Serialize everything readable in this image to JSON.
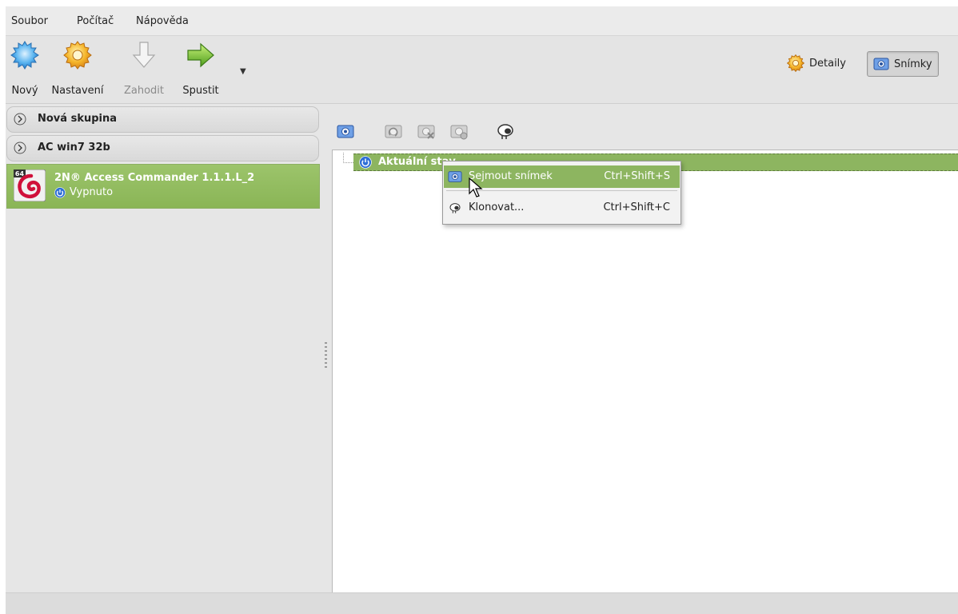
{
  "menubar": {
    "items": [
      {
        "label": "Soubor"
      },
      {
        "label": "Počítač"
      },
      {
        "label": "Nápověda"
      }
    ]
  },
  "toolbar": {
    "buttons": [
      {
        "label": "Nový",
        "icon": "new-vm-icon",
        "enabled": true
      },
      {
        "label": "Nastavení",
        "icon": "settings-gear-icon",
        "enabled": true
      },
      {
        "label": "Zahodit",
        "icon": "discard-arrow-icon",
        "enabled": false
      },
      {
        "label": "Spustit",
        "icon": "start-arrow-icon",
        "enabled": true
      }
    ],
    "details_label": "Detaily",
    "snapshots_label": "Snímky"
  },
  "vm_list": {
    "groups": [
      {
        "label": "Nová skupina"
      },
      {
        "label": "AC win7 32b"
      }
    ],
    "selected_vm": {
      "name": "2N® Access Commander 1.1.1.L_2",
      "state": "Vypnuto",
      "badge": "64"
    }
  },
  "snapshots": {
    "toolbar_icons": [
      "take-snapshot-icon",
      "restore-snapshot-icon",
      "delete-snapshot-icon",
      "snapshot-details-icon",
      "clone-sheep-icon"
    ],
    "current_state_label": "Aktuální stav"
  },
  "context_menu": {
    "items": [
      {
        "label": "Sejmout snímek",
        "shortcut": "Ctrl+Shift+S",
        "icon": "take-snapshot-icon",
        "hovered": true
      },
      {
        "label": "Klonovat...",
        "shortcut": "Ctrl+Shift+C",
        "icon": "clone-sheep-icon",
        "hovered": false
      }
    ]
  },
  "colors": {
    "selection_green": "#8db560",
    "background": "#e6e6e6"
  }
}
